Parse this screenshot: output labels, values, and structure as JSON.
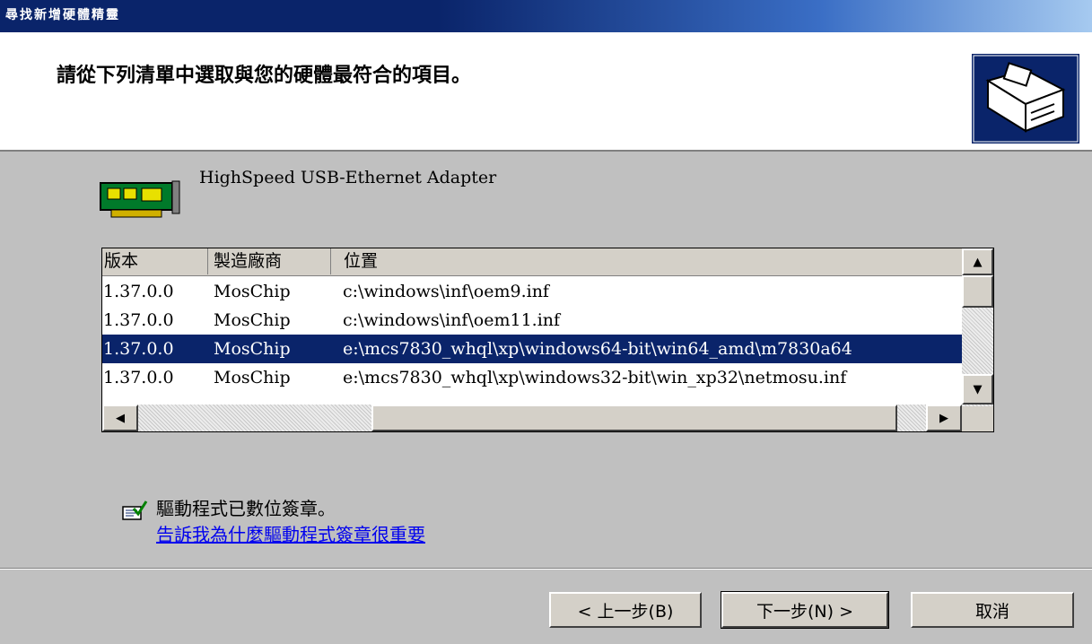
{
  "window": {
    "title": "尋找新增硬體精靈"
  },
  "header": {
    "prompt": "請從下列清單中選取與您的硬體最符合的項目。",
    "hardware_icon": "hardware-install-icon"
  },
  "device": {
    "icon": "network-card-icon",
    "name": "HighSpeed USB-Ethernet Adapter"
  },
  "driver_list": {
    "columns": [
      "版本",
      "製造廠商",
      "位置"
    ],
    "rows": [
      {
        "version": "1.37.0.0",
        "manufacturer": "MosChip",
        "location": "c:\\windows\\inf\\oem9.inf",
        "selected": false
      },
      {
        "version": "1.37.0.0",
        "manufacturer": "MosChip",
        "location": "c:\\windows\\inf\\oem11.inf",
        "selected": false
      },
      {
        "version": "1.37.0.0",
        "manufacturer": "MosChip",
        "location": "e:\\mcs7830_whql\\xp\\windows64-bit\\win64_amd\\m7830a64",
        "selected": true
      },
      {
        "version": "1.37.0.0",
        "manufacturer": "MosChip",
        "location": "e:\\mcs7830_whql\\xp\\windows32-bit\\win_xp32\\netmosu.inf",
        "selected": false
      }
    ]
  },
  "signature": {
    "icon": "signed-driver-icon",
    "status_text": "驅動程式已數位簽章。",
    "link_text": "告訴我為什麼驅動程式簽章很重要"
  },
  "buttons": {
    "back": "< 上一步(B)",
    "next": "下一步(N) >",
    "cancel": "取消"
  },
  "colors": {
    "selection": "#0a246a",
    "title_bar": "#0a246a",
    "link": "#0000ee"
  }
}
